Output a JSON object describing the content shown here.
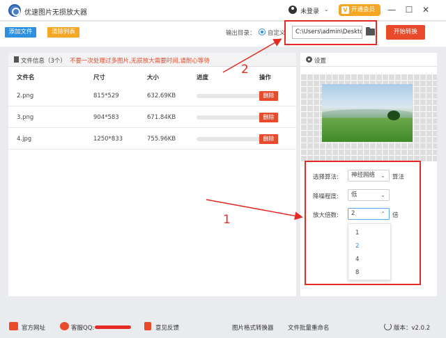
{
  "titlebar": {
    "app_title": "优速图片无损放大器",
    "login_label": "未登录",
    "login_chevron": "⌄",
    "vip_label": "开通会员",
    "vip_icon": "V",
    "minimize": "—",
    "maximize": "☐",
    "close": "✕"
  },
  "toolbar": {
    "add_files": "添加文件",
    "clear_list": "清除列表",
    "output_dir_label": "输出目录：",
    "custom_label": "自定义",
    "output_path": "C:\\Users\\admin\\Desktop",
    "start_button": "开始转换"
  },
  "file_panel": {
    "header_label": "文件信息（3个）",
    "hint": "不要一次处理过多图片,无损放大需要时间,请耐心等待",
    "columns": [
      "文件名",
      "尺寸",
      "大小",
      "进度",
      "操作"
    ],
    "rows": [
      {
        "name": "2.png",
        "dimensions": "815*529",
        "size": "632.69KB",
        "progress": 0,
        "action": "删除"
      },
      {
        "name": "3.png",
        "dimensions": "904*583",
        "size": "671.84KB",
        "progress": 0,
        "action": "删除"
      },
      {
        "name": "4.jpg",
        "dimensions": "1250*833",
        "size": "755.96KB",
        "progress": 0,
        "action": "删除"
      }
    ]
  },
  "settings": {
    "header_label": "设置",
    "algorithm_label": "选择算法:",
    "algorithm_value": "神经网络",
    "algorithm_suffix": "算法",
    "denoise_label": "降噪程度:",
    "denoise_value": "低",
    "scale_label": "放大倍数:",
    "scale_value": "2",
    "scale_suffix": "倍",
    "scale_options": [
      "1",
      "2",
      "4",
      "8"
    ],
    "scale_selected": "2",
    "chevron": "⌄",
    "chevron_up": "⌃"
  },
  "annotations": {
    "num1": "1",
    "num2": "2",
    "color": "#e52a24"
  },
  "footer": {
    "website": "官方网址",
    "qq_label": "客服QQ:",
    "feedback": "意见反馈",
    "format_converter": "图片格式转换器",
    "batch_rename": "文件批量重命名",
    "version": "版本：v2.0.2"
  },
  "colors": {
    "blue": "#2e8fe0",
    "orange": "#f5a623",
    "red": "#e84a2a"
  }
}
